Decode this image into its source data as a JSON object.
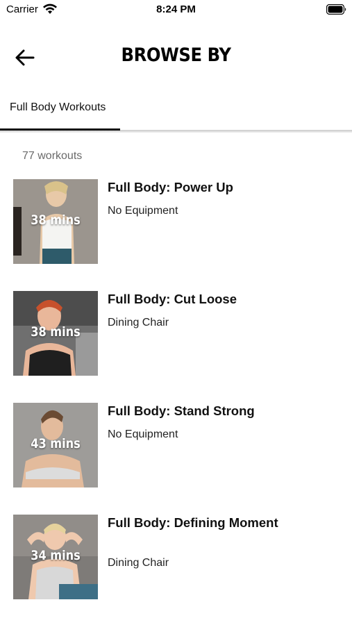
{
  "status_bar": {
    "carrier": "Carrier",
    "time": "8:24 PM"
  },
  "header": {
    "title": "BROWSE BY",
    "back_icon": "arrow-left-icon"
  },
  "tabs": [
    {
      "label": "Full Body Workouts",
      "active": true
    }
  ],
  "list": {
    "count_label": "77 workouts",
    "items": [
      {
        "title": "Full Body: Power Up",
        "equipment": "No Equipment",
        "duration": "38 mins"
      },
      {
        "title": "Full Body: Cut Loose",
        "equipment": "Dining Chair",
        "duration": "38 mins"
      },
      {
        "title": "Full Body: Stand Strong",
        "equipment": "No Equipment",
        "duration": "43 mins"
      },
      {
        "title": "Full Body: Defining Moment",
        "equipment": "Dining Chair",
        "duration": "34 mins"
      }
    ]
  },
  "colors": {
    "tab_indicator": "#111111",
    "count_text": "#6a6a6a"
  }
}
